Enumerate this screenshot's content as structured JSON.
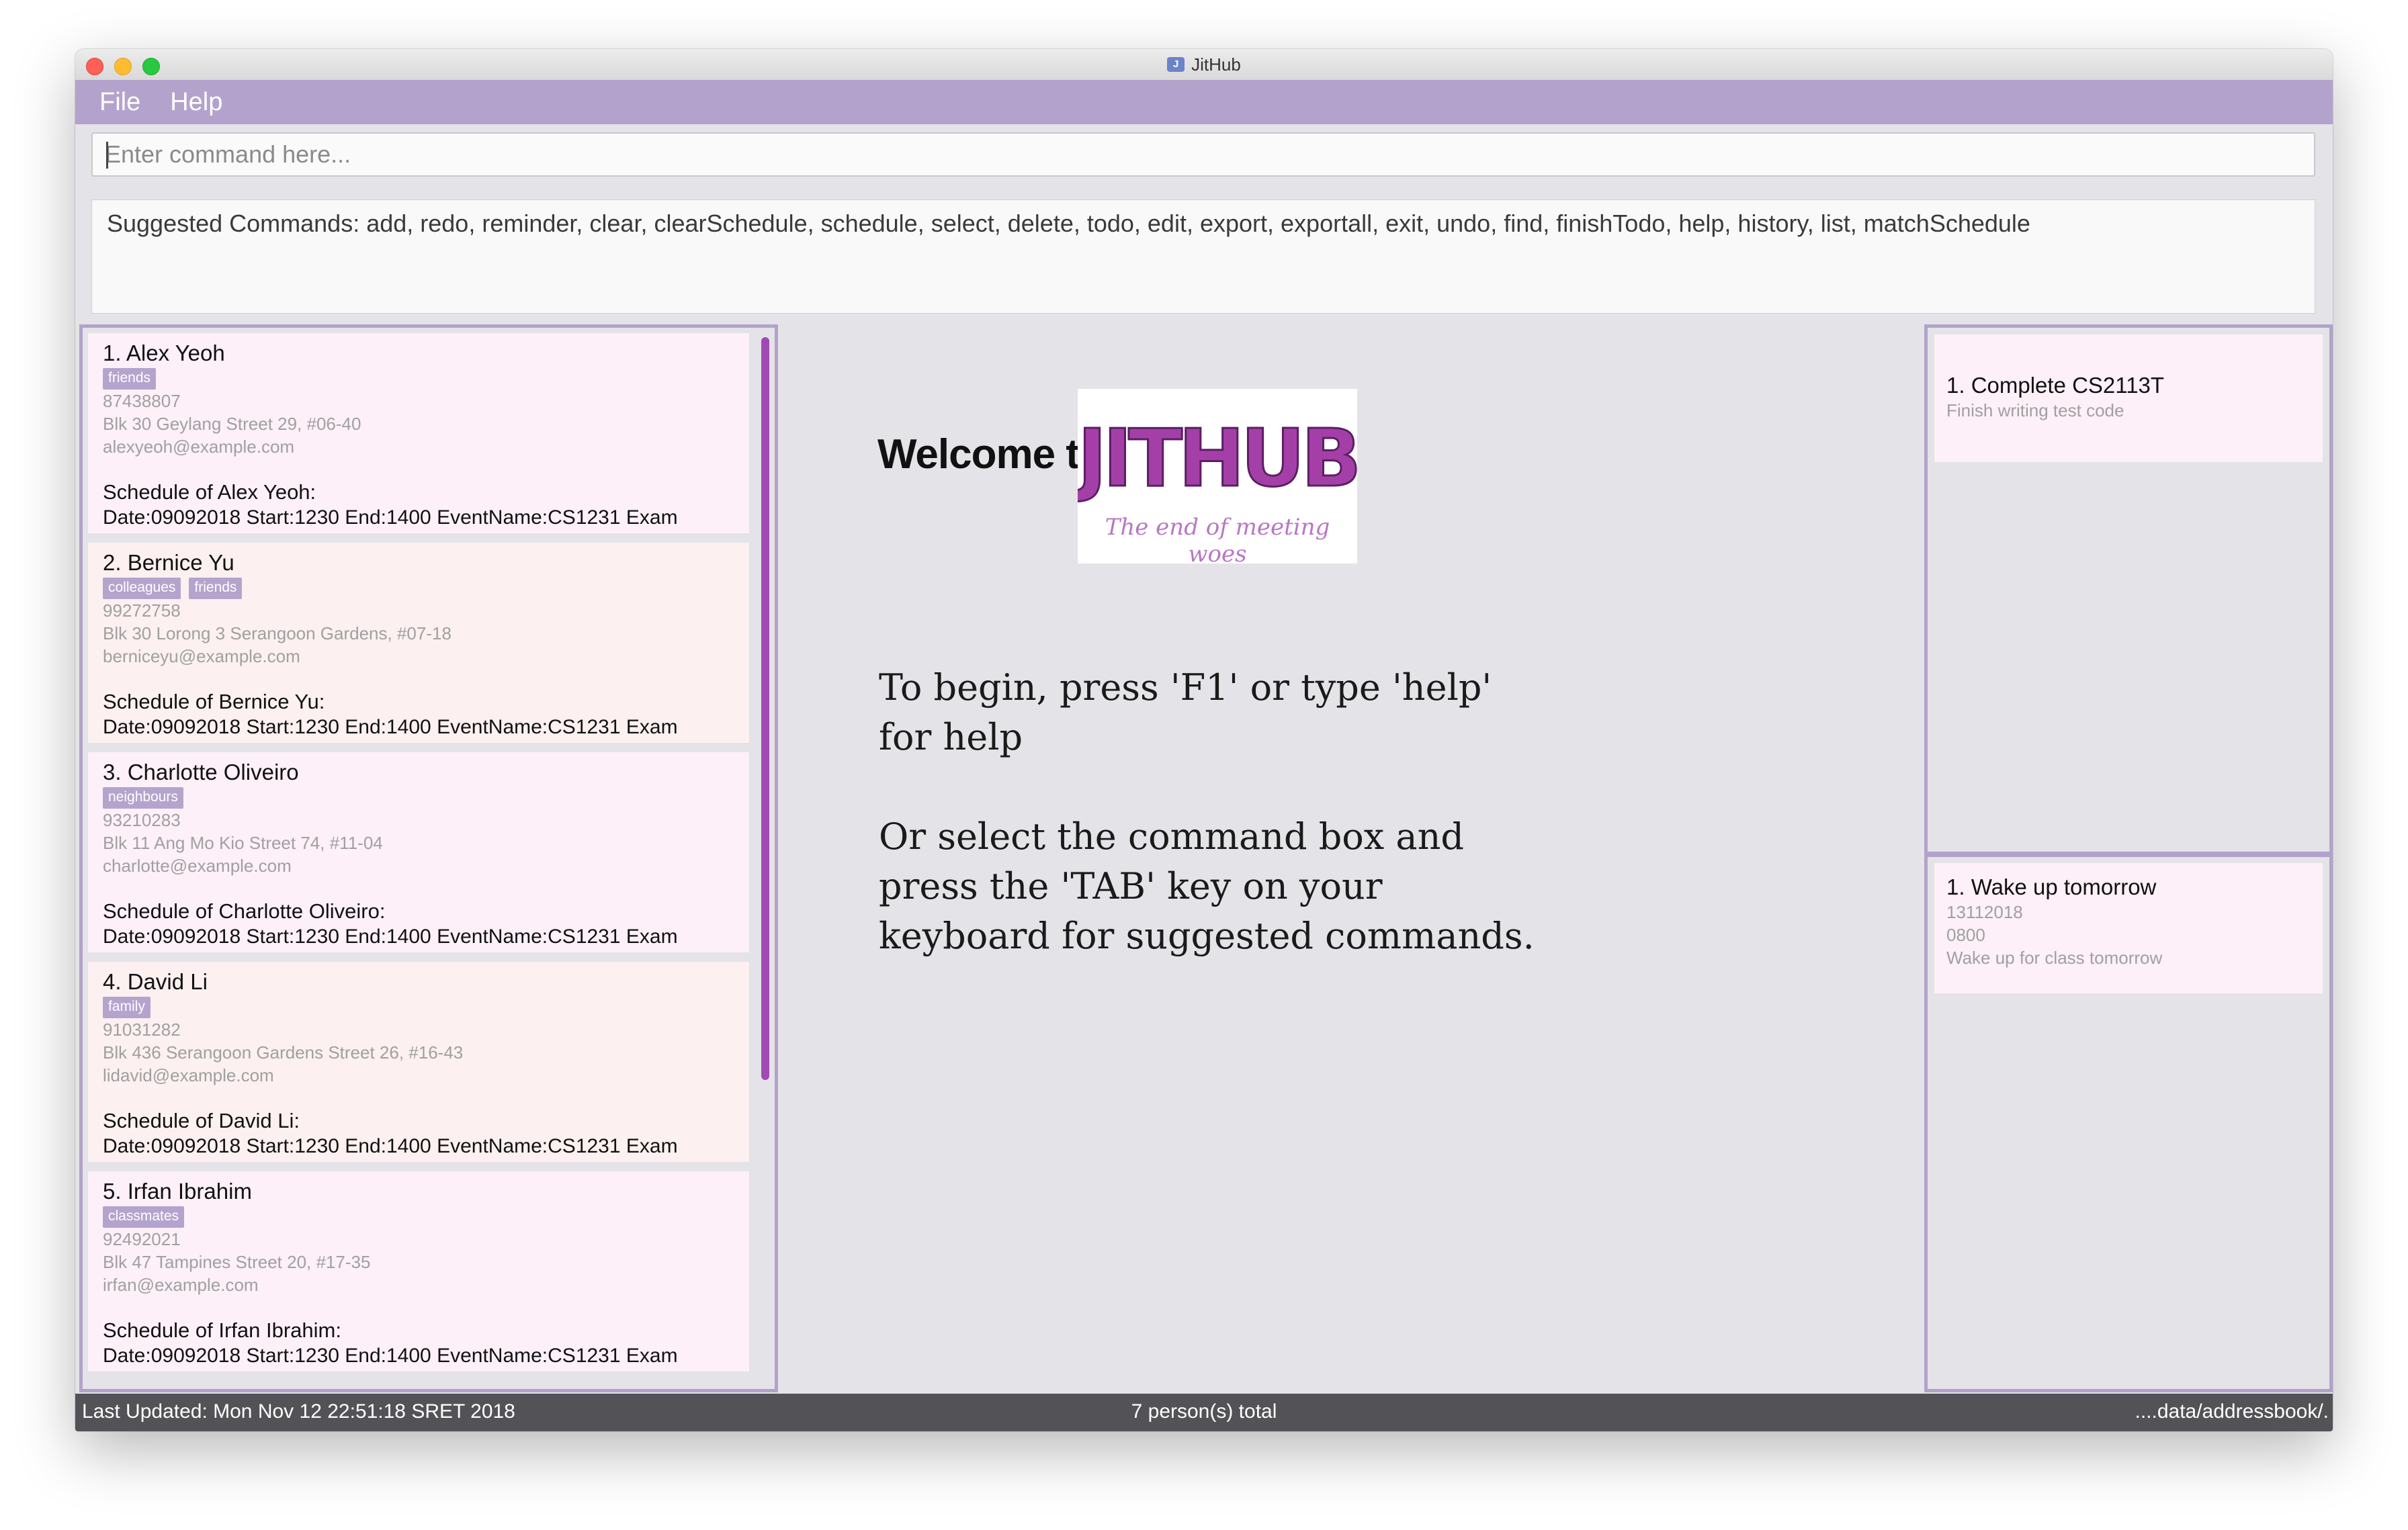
{
  "window": {
    "title": "JitHub",
    "app_icon": "J"
  },
  "menu": {
    "items": [
      "File",
      "Help"
    ]
  },
  "command": {
    "placeholder": "Enter command here...",
    "value": ""
  },
  "result": {
    "text": "Suggested Commands: add, redo, reminder, clear, clearSchedule, schedule, select, delete, todo, edit, export, exportall, exit, undo, find, finishTodo, help, history, list, matchSchedule"
  },
  "persons": [
    {
      "name": "1.  Alex Yeoh",
      "tags": [
        "friends"
      ],
      "phone": "87438807",
      "address": "Blk 30 Geylang Street 29, #06-40",
      "email": "alexyeoh@example.com",
      "schedule_title": "Schedule of Alex Yeoh:",
      "schedule_line": "Date:09092018 Start:1230 End:1400 EventName:CS1231 Exam"
    },
    {
      "name": "2.  Bernice Yu",
      "tags": [
        "colleagues",
        "friends"
      ],
      "phone": "99272758",
      "address": "Blk 30 Lorong 3 Serangoon Gardens, #07-18",
      "email": "berniceyu@example.com",
      "schedule_title": "Schedule of Bernice Yu:",
      "schedule_line": "Date:09092018 Start:1230 End:1400 EventName:CS1231 Exam"
    },
    {
      "name": "3.  Charlotte Oliveiro",
      "tags": [
        "neighbours"
      ],
      "phone": "93210283",
      "address": "Blk 11 Ang Mo Kio Street 74, #11-04",
      "email": "charlotte@example.com",
      "schedule_title": "Schedule of Charlotte Oliveiro:",
      "schedule_line": "Date:09092018 Start:1230 End:1400 EventName:CS1231 Exam"
    },
    {
      "name": "4.  David Li",
      "tags": [
        "family"
      ],
      "phone": "91031282",
      "address": "Blk 436 Serangoon Gardens Street 26, #16-43",
      "email": "lidavid@example.com",
      "schedule_title": "Schedule of David Li:",
      "schedule_line": "Date:09092018 Start:1230 End:1400 EventName:CS1231 Exam"
    },
    {
      "name": "5.  Irfan Ibrahim",
      "tags": [
        "classmates"
      ],
      "phone": "92492021",
      "address": "Blk 47 Tampines Street 20, #17-35",
      "email": "irfan@example.com",
      "schedule_title": "Schedule of Irfan Ibrahim:",
      "schedule_line": "Date:09092018 Start:1230 End:1400 EventName:CS1231 Exam"
    }
  ],
  "welcome": {
    "heading": "Welcome to",
    "logo_text": "JITHUB",
    "logo_tagline": "The end of meeting woes",
    "line1": "To begin, press 'F1' or type 'help'",
    "line2": "for help",
    "line3": "Or select the command box and",
    "line4": "press the 'TAB' key on your",
    "line5": "keyboard for suggested commands."
  },
  "todos": [
    {
      "title": "1.  Complete CS2113T",
      "description": "Finish writing test code"
    }
  ],
  "reminders": [
    {
      "title": "1.  Wake up tomorrow",
      "date": "13112018",
      "time": "0800",
      "description": "Wake up for class tomorrow"
    }
  ],
  "status": {
    "last_updated": "Last Updated: Mon Nov 12 22:51:18 SRET 2018",
    "total": "7 person(s) total",
    "path": "....data/addressbook/."
  },
  "colors": {
    "accent": "#b3a3cc",
    "scrollbar": "#a24ab4",
    "statusbar": "#535357",
    "logo": "#a43fa8"
  }
}
